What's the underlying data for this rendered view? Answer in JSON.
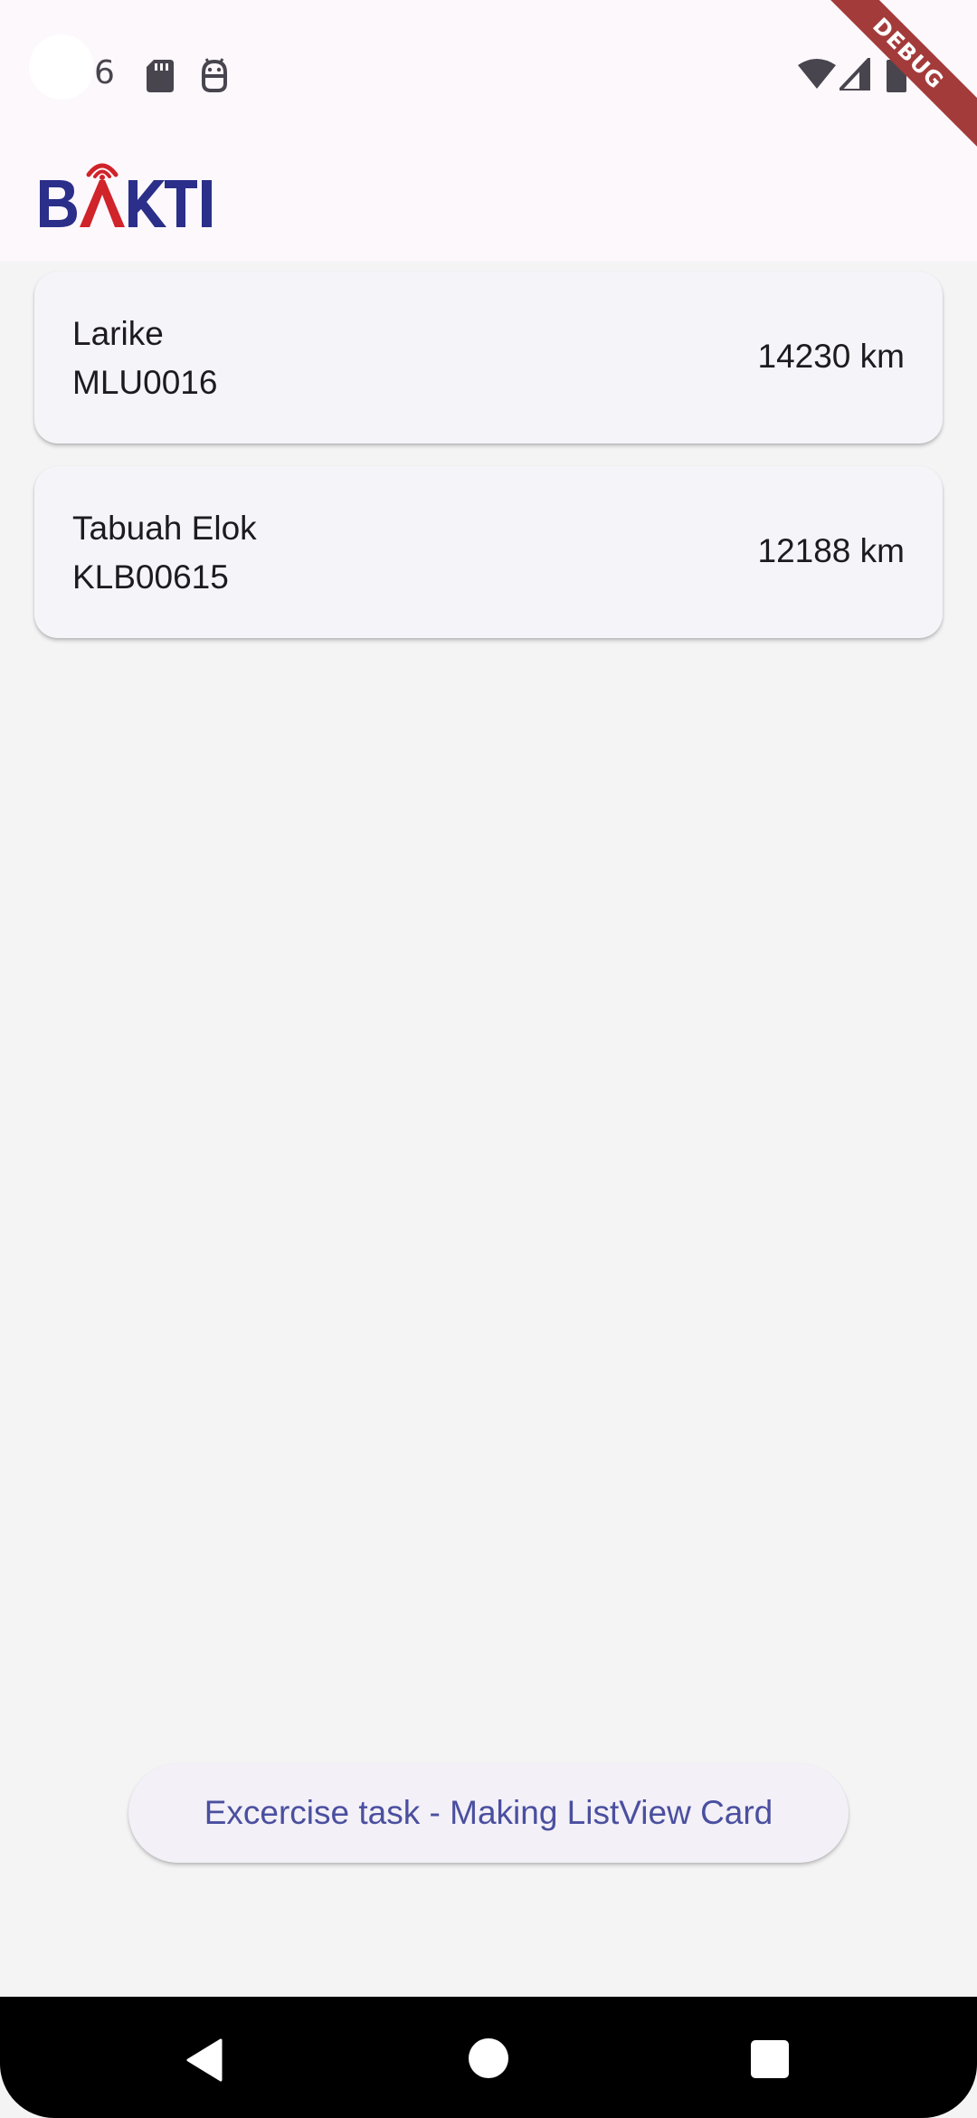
{
  "status_bar": {
    "time": "6",
    "icons": [
      "sd-card-icon",
      "android-debug-icon",
      "wifi-icon",
      "cell-signal-icon",
      "battery-icon"
    ]
  },
  "app_bar": {
    "logo_text": "BAKTI",
    "logo_colors": {
      "primary": "#2b2f8a",
      "accent": "#d0232a"
    }
  },
  "debug_banner": "DEBUG",
  "cards": [
    {
      "name": "Larike",
      "code": "MLU0016",
      "distance": "14230 km"
    },
    {
      "name": "Tabuah Elok",
      "code": "KLB00615",
      "distance": "12188 km"
    }
  ],
  "task_button": {
    "label": "Excercise task - Making ListView Card"
  },
  "nav_bar": {
    "icons": [
      "back-icon",
      "home-icon",
      "recents-icon"
    ]
  },
  "colors": {
    "background": "#f4f4f5",
    "card": "#f4f4f9",
    "button_text": "#4a4f9f",
    "debug_ribbon": "#a43b3b"
  }
}
